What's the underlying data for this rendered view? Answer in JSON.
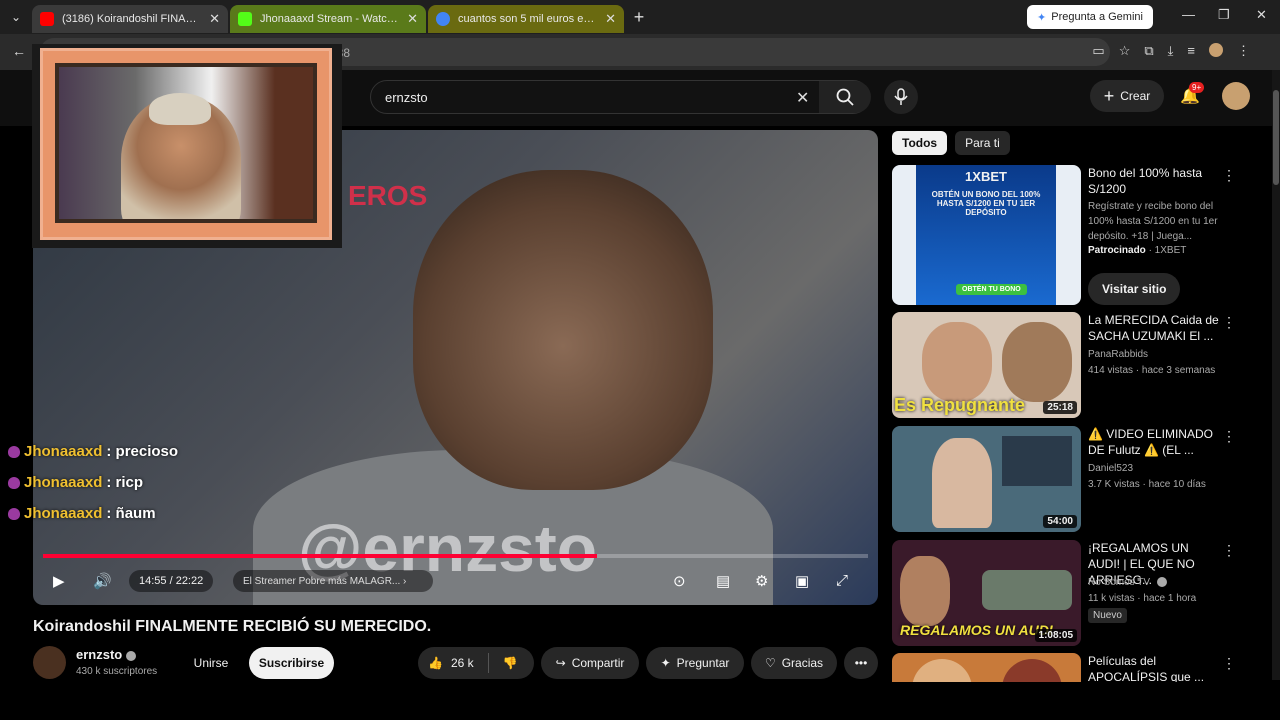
{
  "browser": {
    "tabs": [
      {
        "title": "(3186) Koirandoshil FINALMENTE",
        "fav_color": "#ff0000"
      },
      {
        "title": "Jhonaaaxd Stream - Watch Live",
        "fav_color": "#53fc18"
      },
      {
        "title": "cuantos son 5 mil euros en sole",
        "fav_color": "#4285f4"
      }
    ],
    "new_tab": "+",
    "gemini_label": "Pregunta a Gemini",
    "address_fragment": "088"
  },
  "yt": {
    "search_value": "ernzsto",
    "create_label": "Crear",
    "notif_badge": "9+"
  },
  "video": {
    "chat": [
      {
        "name": "Jhonaaaxd",
        "msg": ": precioso"
      },
      {
        "name": "Jhonaaaxd",
        "msg": ": ricp"
      },
      {
        "name": "Jhonaaaxd",
        "msg": ": ñaum"
      }
    ],
    "watermark": "@ernzsto",
    "bg_text": "EROS",
    "time": "14:55 / 22:22",
    "progress": 0.672,
    "chapter": "El Streamer Pobre más MALAGR... ›",
    "title": "Koirandoshil FINALMENTE RECIBIÓ SU MERECIDO."
  },
  "channel": {
    "name": "ernzsto",
    "subs": "430 k suscriptores",
    "join": "Unirse",
    "subscribe": "Suscribirse",
    "likes": "26 k",
    "share": "Compartir",
    "ask": "Preguntar",
    "thanks": "Gracias"
  },
  "sidebar": {
    "chips": [
      "Todos",
      "Para ti"
    ],
    "ad": {
      "title": "Bono del 100% hasta S/1200",
      "desc": "Regístrate y recibe bono del 100% hasta S/1200 en tu 1er depósito. +18 | Juega...",
      "sponsored": "Patrocinado",
      "advertiser": " · 1XBET",
      "cta": "Visitar sitio",
      "thumb_brand": "1XBET",
      "thumb_text": "OBTÉN UN BONO DEL 100% HASTA S/1200 EN TU 1ER DEPÓSITO",
      "thumb_btn": "OBTÉN TU BONO"
    },
    "videos": [
      {
        "title": "La MERECIDA Caida de SACHA UZUMAKI El ...",
        "channel": "PanaRabbids",
        "meta": "414 vistas · hace 3 semanas",
        "duration": "25:18",
        "thumb_text": "Es Repugnante",
        "thumb_color": "#d8c8b8"
      },
      {
        "title": "⚠️ VIDEO ELIMINADO DE Fulutz ⚠️ (EL ...",
        "channel": "Daniel523",
        "meta": "3.7 K vistas · hace 10 días",
        "duration": "54:00",
        "thumb_text": "",
        "thumb_color": "#4a6a7a"
      },
      {
        "title": "¡REGALAMOS UN AUDI! | EL QUE NO ARRIESG...",
        "channel": "No Somos TV",
        "meta": "11 k vistas · hace 1 hora",
        "duration": "1:08:05",
        "thumb_text": "REGALAMOS UN AUDI",
        "thumb_color": "#3a1a2a",
        "badge": "Nuevo"
      },
      {
        "title": "Películas del APOCALÍPSIS que ...",
        "channel": "",
        "meta": "",
        "duration": "",
        "thumb_text": "",
        "thumb_color": "#c87a3a"
      }
    ]
  }
}
